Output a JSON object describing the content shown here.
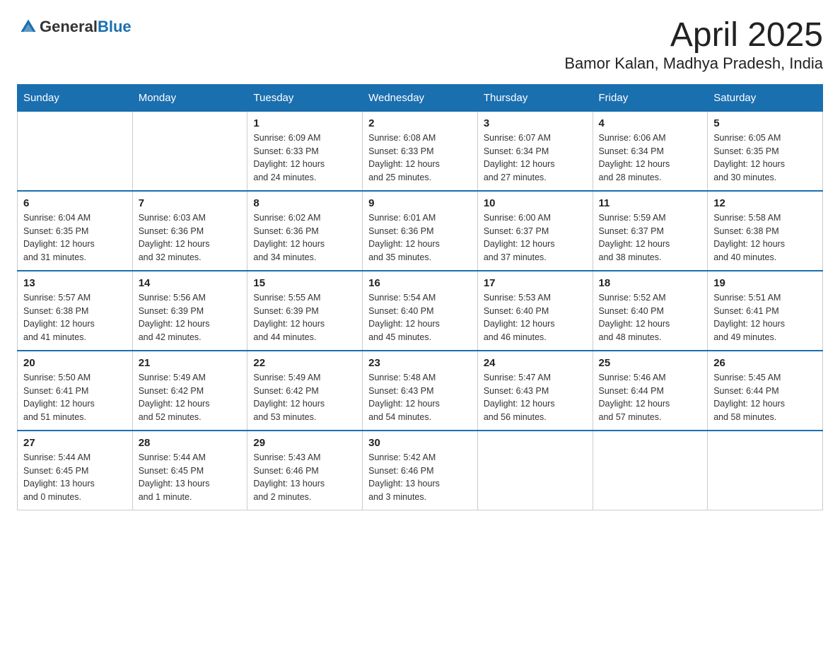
{
  "logo": {
    "general": "General",
    "blue": "Blue"
  },
  "title": "April 2025",
  "subtitle": "Bamor Kalan, Madhya Pradesh, India",
  "headers": [
    "Sunday",
    "Monday",
    "Tuesday",
    "Wednesday",
    "Thursday",
    "Friday",
    "Saturday"
  ],
  "weeks": [
    [
      {
        "day": "",
        "info": ""
      },
      {
        "day": "",
        "info": ""
      },
      {
        "day": "1",
        "info": "Sunrise: 6:09 AM\nSunset: 6:33 PM\nDaylight: 12 hours\nand 24 minutes."
      },
      {
        "day": "2",
        "info": "Sunrise: 6:08 AM\nSunset: 6:33 PM\nDaylight: 12 hours\nand 25 minutes."
      },
      {
        "day": "3",
        "info": "Sunrise: 6:07 AM\nSunset: 6:34 PM\nDaylight: 12 hours\nand 27 minutes."
      },
      {
        "day": "4",
        "info": "Sunrise: 6:06 AM\nSunset: 6:34 PM\nDaylight: 12 hours\nand 28 minutes."
      },
      {
        "day": "5",
        "info": "Sunrise: 6:05 AM\nSunset: 6:35 PM\nDaylight: 12 hours\nand 30 minutes."
      }
    ],
    [
      {
        "day": "6",
        "info": "Sunrise: 6:04 AM\nSunset: 6:35 PM\nDaylight: 12 hours\nand 31 minutes."
      },
      {
        "day": "7",
        "info": "Sunrise: 6:03 AM\nSunset: 6:36 PM\nDaylight: 12 hours\nand 32 minutes."
      },
      {
        "day": "8",
        "info": "Sunrise: 6:02 AM\nSunset: 6:36 PM\nDaylight: 12 hours\nand 34 minutes."
      },
      {
        "day": "9",
        "info": "Sunrise: 6:01 AM\nSunset: 6:36 PM\nDaylight: 12 hours\nand 35 minutes."
      },
      {
        "day": "10",
        "info": "Sunrise: 6:00 AM\nSunset: 6:37 PM\nDaylight: 12 hours\nand 37 minutes."
      },
      {
        "day": "11",
        "info": "Sunrise: 5:59 AM\nSunset: 6:37 PM\nDaylight: 12 hours\nand 38 minutes."
      },
      {
        "day": "12",
        "info": "Sunrise: 5:58 AM\nSunset: 6:38 PM\nDaylight: 12 hours\nand 40 minutes."
      }
    ],
    [
      {
        "day": "13",
        "info": "Sunrise: 5:57 AM\nSunset: 6:38 PM\nDaylight: 12 hours\nand 41 minutes."
      },
      {
        "day": "14",
        "info": "Sunrise: 5:56 AM\nSunset: 6:39 PM\nDaylight: 12 hours\nand 42 minutes."
      },
      {
        "day": "15",
        "info": "Sunrise: 5:55 AM\nSunset: 6:39 PM\nDaylight: 12 hours\nand 44 minutes."
      },
      {
        "day": "16",
        "info": "Sunrise: 5:54 AM\nSunset: 6:40 PM\nDaylight: 12 hours\nand 45 minutes."
      },
      {
        "day": "17",
        "info": "Sunrise: 5:53 AM\nSunset: 6:40 PM\nDaylight: 12 hours\nand 46 minutes."
      },
      {
        "day": "18",
        "info": "Sunrise: 5:52 AM\nSunset: 6:40 PM\nDaylight: 12 hours\nand 48 minutes."
      },
      {
        "day": "19",
        "info": "Sunrise: 5:51 AM\nSunset: 6:41 PM\nDaylight: 12 hours\nand 49 minutes."
      }
    ],
    [
      {
        "day": "20",
        "info": "Sunrise: 5:50 AM\nSunset: 6:41 PM\nDaylight: 12 hours\nand 51 minutes."
      },
      {
        "day": "21",
        "info": "Sunrise: 5:49 AM\nSunset: 6:42 PM\nDaylight: 12 hours\nand 52 minutes."
      },
      {
        "day": "22",
        "info": "Sunrise: 5:49 AM\nSunset: 6:42 PM\nDaylight: 12 hours\nand 53 minutes."
      },
      {
        "day": "23",
        "info": "Sunrise: 5:48 AM\nSunset: 6:43 PM\nDaylight: 12 hours\nand 54 minutes."
      },
      {
        "day": "24",
        "info": "Sunrise: 5:47 AM\nSunset: 6:43 PM\nDaylight: 12 hours\nand 56 minutes."
      },
      {
        "day": "25",
        "info": "Sunrise: 5:46 AM\nSunset: 6:44 PM\nDaylight: 12 hours\nand 57 minutes."
      },
      {
        "day": "26",
        "info": "Sunrise: 5:45 AM\nSunset: 6:44 PM\nDaylight: 12 hours\nand 58 minutes."
      }
    ],
    [
      {
        "day": "27",
        "info": "Sunrise: 5:44 AM\nSunset: 6:45 PM\nDaylight: 13 hours\nand 0 minutes."
      },
      {
        "day": "28",
        "info": "Sunrise: 5:44 AM\nSunset: 6:45 PM\nDaylight: 13 hours\nand 1 minute."
      },
      {
        "day": "29",
        "info": "Sunrise: 5:43 AM\nSunset: 6:46 PM\nDaylight: 13 hours\nand 2 minutes."
      },
      {
        "day": "30",
        "info": "Sunrise: 5:42 AM\nSunset: 6:46 PM\nDaylight: 13 hours\nand 3 minutes."
      },
      {
        "day": "",
        "info": ""
      },
      {
        "day": "",
        "info": ""
      },
      {
        "day": "",
        "info": ""
      }
    ]
  ]
}
